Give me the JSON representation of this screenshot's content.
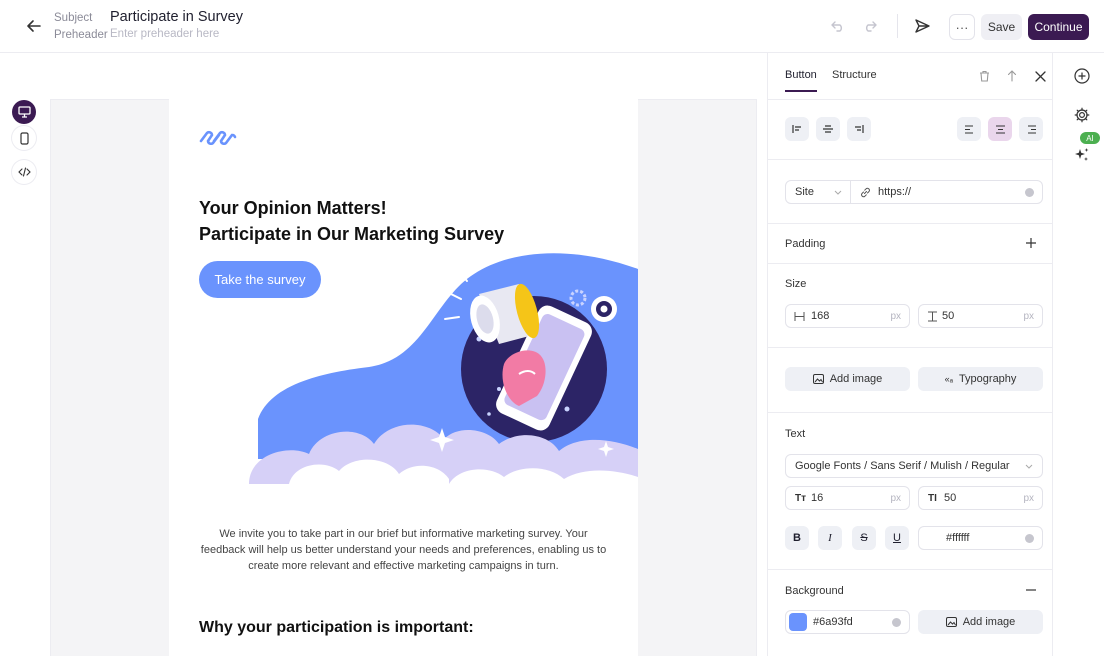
{
  "topbar": {
    "subject_label": "Subject",
    "preheader_label": "Preheader",
    "subject_value": "Participate in Survey",
    "preheader_placeholder": "Enter preheader here",
    "more_label": "···",
    "save_label": "Save",
    "continue_label": "Continue"
  },
  "email": {
    "title_line1": "Your Opinion Matters!",
    "title_line2": "Participate in Our Marketing Survey",
    "cta_label": "Take the survey",
    "body_text": "We invite you to take part in our brief but informative marketing survey. Your feedback will help us better understand your needs and preferences, enabling us to create more relevant and effective marketing campaigns in turn.",
    "heading2": "Why your participation is important:"
  },
  "panel": {
    "tabs": [
      {
        "label": "Button",
        "active": true
      },
      {
        "label": "Structure",
        "active": false
      }
    ],
    "link": {
      "type": "Site",
      "url": "https://"
    },
    "padding_label": "Padding",
    "size": {
      "label": "Size",
      "width": "168",
      "height": "50",
      "unit": "px"
    },
    "add_image_label": "Add image",
    "typography_label": "Typography",
    "text": {
      "label": "Text",
      "font": "Google Fonts / Sans Serif / Mulish / Regular",
      "size": "16",
      "line_height": "50",
      "unit": "px",
      "color": "#ffffff"
    },
    "background": {
      "label": "Background",
      "color": "#6a93fd",
      "add_image_label": "Add image"
    }
  },
  "rail": {
    "ai_label": "AI"
  },
  "colors": {
    "brand": "#3b1a52",
    "accent": "#6a93fd",
    "ai_green": "#4caf50"
  }
}
